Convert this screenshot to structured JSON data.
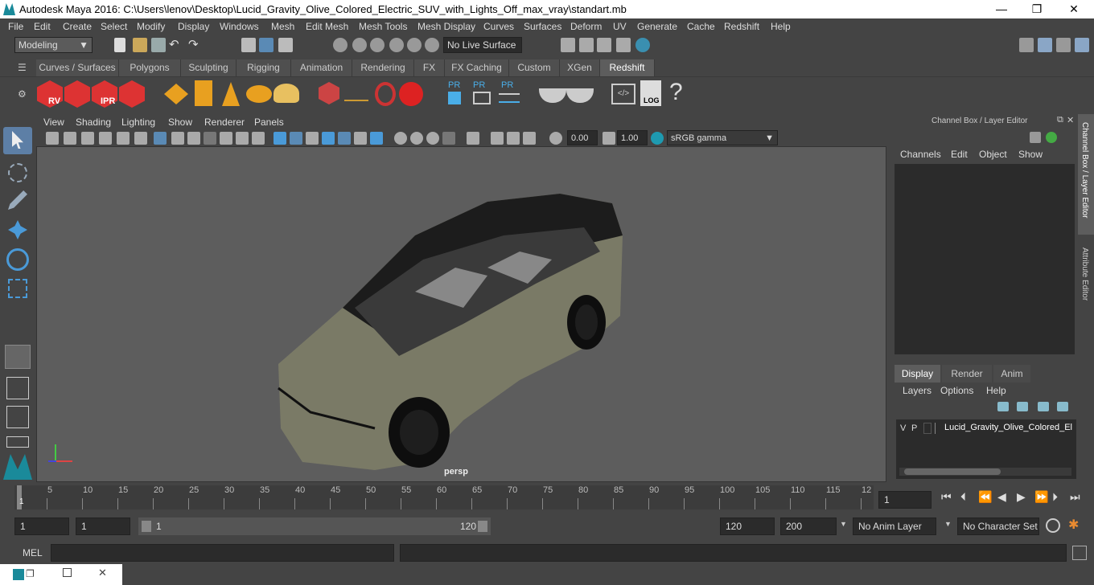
{
  "window": {
    "title": "Autodesk Maya 2016: C:\\Users\\lenov\\Desktop\\Lucid_Gravity_Olive_Colored_Electric_SUV_with_Lights_Off_max_vray\\standart.mb",
    "minimize": "—",
    "restore": "❐",
    "close": "✕"
  },
  "menus": [
    "File",
    "Edit",
    "Create",
    "Select",
    "Modify",
    "Display",
    "Windows",
    "Mesh",
    "Edit Mesh",
    "Mesh Tools",
    "Mesh Display",
    "Curves",
    "Surfaces",
    "Deform",
    "UV",
    "Generate",
    "Cache",
    "Redshift",
    "Help"
  ],
  "status": {
    "mode": "Modeling",
    "live_surface": "No Live Surface"
  },
  "shelf_tabs": [
    "Curves / Surfaces",
    "Polygons",
    "Sculpting",
    "Rigging",
    "Animation",
    "Rendering",
    "FX",
    "FX Caching",
    "Custom",
    "XGen",
    "Redshift"
  ],
  "shelf_active": "Redshift",
  "shelf_icons": {
    "rv": "RV",
    "ipr": "IPR",
    "pr": "PR",
    "log": "LOG",
    "help": "?"
  },
  "viewport": {
    "menus": [
      "View",
      "Shading",
      "Lighting",
      "Show",
      "Renderer",
      "Panels"
    ],
    "exposure": "0.00",
    "gamma": "1.00",
    "colorspace": "sRGB gamma",
    "camera": "persp"
  },
  "channel_box": {
    "title": "Channel Box / Layer Editor",
    "menus": [
      "Channels",
      "Edit",
      "Object",
      "Show"
    ],
    "tabs": [
      "Display",
      "Render",
      "Anim"
    ],
    "active_tab": "Display",
    "layer_menus": [
      "Layers",
      "Options",
      "Help"
    ],
    "layer": {
      "v": "V",
      "p": "P",
      "name": "Lucid_Gravity_Olive_Colored_El"
    }
  },
  "side_tabs": {
    "channel": "Channel Box / Layer Editor",
    "attr": "Attribute Editor"
  },
  "timeline": {
    "labels": [
      "1",
      "5",
      "10",
      "15",
      "20",
      "25",
      "30",
      "35",
      "40",
      "45",
      "50",
      "55",
      "60",
      "65",
      "70",
      "75",
      "80",
      "85",
      "90",
      "95",
      "100",
      "105",
      "110",
      "115",
      "12"
    ],
    "current": "1"
  },
  "range": {
    "start": "1",
    "start2": "1",
    "slider_min": "1",
    "slider_max": "120",
    "end": "120",
    "end2": "200",
    "anim_layer": "No Anim Layer",
    "char_set": "No Character Set"
  },
  "mel": {
    "label": "MEL"
  }
}
